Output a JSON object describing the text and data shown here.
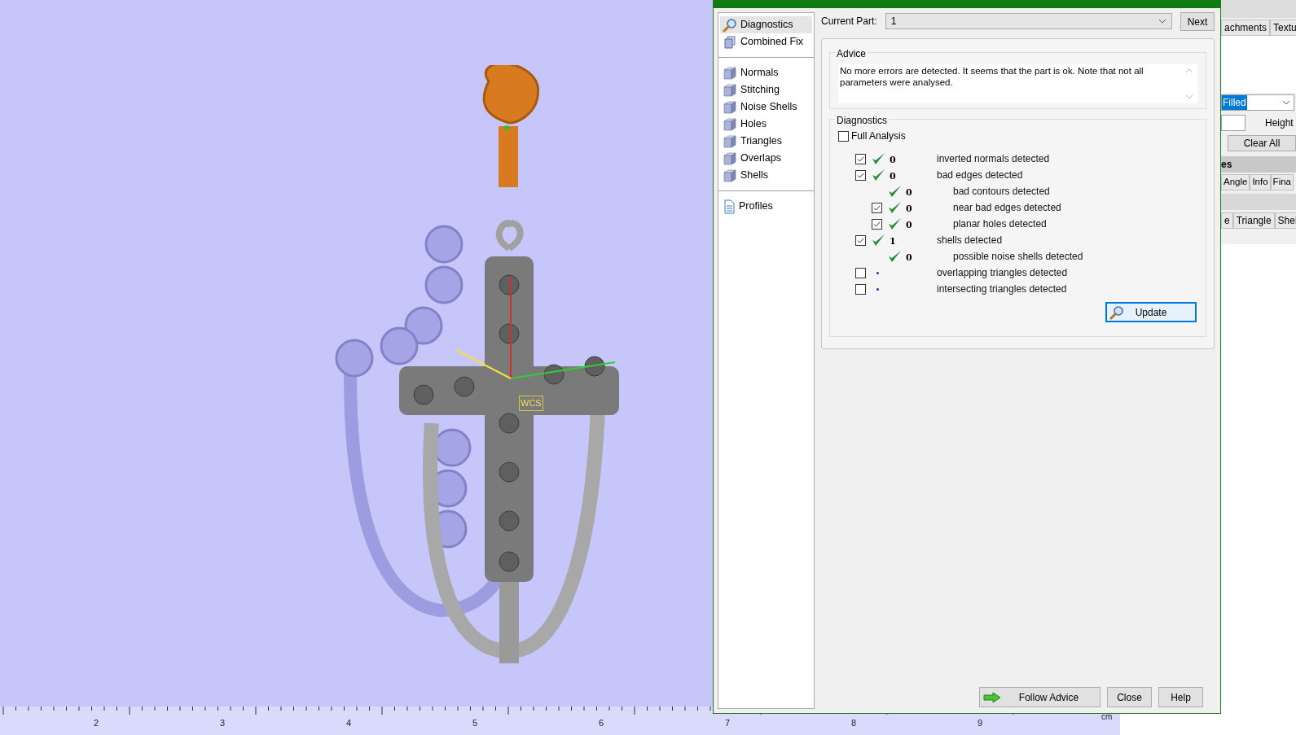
{
  "viewport": {
    "axis_label": "WCS",
    "ruler": {
      "labels": [
        "2",
        "3",
        "4",
        "5",
        "6",
        "7",
        "8",
        "9"
      ],
      "unit": "cm"
    }
  },
  "dialog": {
    "nav": [
      [
        {
          "label": "Diagnostics",
          "kind": "search",
          "selected": true
        },
        {
          "label": "Combined Fix",
          "kind": "cubes",
          "selected": false
        }
      ],
      [
        {
          "label": "Normals",
          "kind": "cube",
          "selected": false
        },
        {
          "label": "Stitching",
          "kind": "cube",
          "selected": false
        },
        {
          "label": "Noise Shells",
          "kind": "cube",
          "selected": false
        },
        {
          "label": "Holes",
          "kind": "cube",
          "selected": false
        },
        {
          "label": "Triangles",
          "kind": "cube",
          "selected": false
        },
        {
          "label": "Overlaps",
          "kind": "cube",
          "selected": false
        },
        {
          "label": "Shells",
          "kind": "cube",
          "selected": false
        }
      ],
      [
        {
          "label": "Profiles",
          "kind": "document",
          "selected": false
        }
      ]
    ],
    "current_part": {
      "label": "Current Part:",
      "value": "1",
      "next_button": "Next"
    },
    "advice": {
      "title": "Advice",
      "text": "No more errors are detected. It seems that the part is ok. Note that not all parameters were analysed."
    },
    "diagnostics": {
      "title": "Diagnostics",
      "full_analysis": {
        "label": "Full Analysis",
        "checked": false
      },
      "rows": [
        {
          "kind": "check",
          "checked": true,
          "passed": true,
          "count": "0",
          "label": "inverted normals detected"
        },
        {
          "kind": "check",
          "checked": true,
          "passed": true,
          "count": "0",
          "label": "bad edges detected",
          "children": [
            {
              "kind": "plain",
              "passed": true,
              "count": "0",
              "label": "bad contours detected"
            },
            {
              "kind": "check",
              "checked": true,
              "passed": true,
              "count": "0",
              "label": "near bad edges detected"
            },
            {
              "kind": "check",
              "checked": true,
              "passed": true,
              "count": "0",
              "label": "planar holes detected"
            }
          ]
        },
        {
          "kind": "check",
          "checked": true,
          "passed": true,
          "count": "1",
          "label": "shells detected",
          "children": [
            {
              "kind": "plain",
              "passed": true,
              "count": "0",
              "label": "possible noise shells detected"
            }
          ]
        },
        {
          "kind": "check",
          "checked": false,
          "passed": false,
          "label": "overlapping triangles detected"
        },
        {
          "kind": "check",
          "checked": false,
          "passed": false,
          "label": "intersecting triangles detected"
        }
      ],
      "update_button": "Update"
    },
    "buttons": [
      {
        "label": "Follow Advice",
        "kind": "arrow"
      },
      {
        "label": "Close",
        "kind": "plain"
      },
      {
        "label": "Help",
        "kind": "plain"
      }
    ]
  },
  "side_panel": {
    "tabs_top": [
      "achments",
      "Textu"
    ],
    "fill_select": "Filled",
    "height_label": "Height",
    "clear_button": "Clear All",
    "section_header": "es",
    "tabs_middle": [
      "Angle",
      "Info",
      "Fina"
    ],
    "tabs_bottom": [
      "e",
      "Triangle",
      "Shel"
    ]
  }
}
